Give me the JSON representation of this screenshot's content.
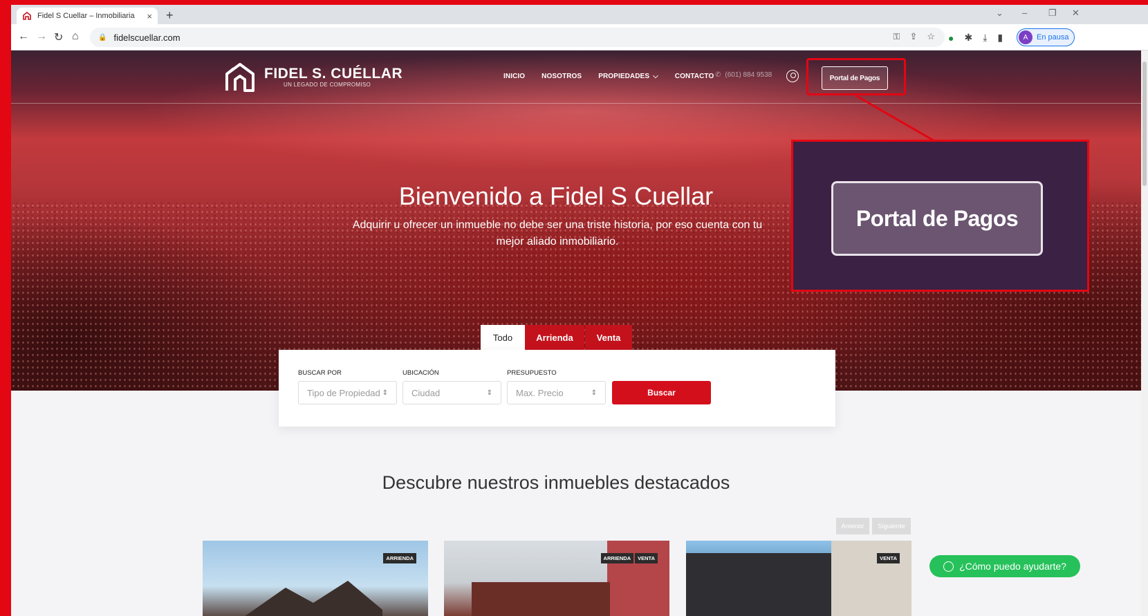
{
  "browser": {
    "tab_title": "Fidel S Cuellar – Inmobiliaria",
    "tab_close": "×",
    "new_tab": "+",
    "url": "fidelscuellar.com",
    "profile_initial": "A",
    "profile_status": "En pausa"
  },
  "site": {
    "brand_name": "FIDEL S. CUÉLLAR",
    "brand_tagline": "UN LEGADO DE COMPROMISO",
    "nav": {
      "inicio": "INICIO",
      "nosotros": "NOSOTROS",
      "propiedades": "PROPIEDADES",
      "contacto": "CONTACTO"
    },
    "phone": "(601) 884 9538",
    "portal_button": "Portal de Pagos"
  },
  "hero": {
    "title": "Bienvenido a Fidel S Cuellar",
    "subtitle": "Adquirir u ofrecer un inmueble no debe ser una triste historia, por eso cuenta con tu mejor aliado inmobiliario."
  },
  "callout": {
    "zoom_label": "Portal de Pagos"
  },
  "search": {
    "tabs": [
      "Todo",
      "Arrienda",
      "Venta"
    ],
    "active_tab": "Todo",
    "fields": [
      {
        "label": "BUSCAR POR",
        "placeholder": "Tipo de Propiedad"
      },
      {
        "label": "UBICACIÓN",
        "placeholder": "Ciudad"
      },
      {
        "label": "PRESUPUESTO",
        "placeholder": "Max. Precio"
      }
    ],
    "button": "Buscar"
  },
  "featured": {
    "title": "Descubre nuestros inmuebles destacados",
    "prev": "Anterior",
    "next": "Siguiente",
    "cards": [
      {
        "badges": [
          "ARRIENDA"
        ]
      },
      {
        "badges": [
          "ARRIENDA",
          "VENTA"
        ]
      },
      {
        "badges": [
          "VENTA"
        ]
      }
    ]
  },
  "whatsapp": {
    "label": "¿Cómo puedo ayudarte?"
  },
  "colors": {
    "brand_red": "#d40f1c",
    "annotation_red": "#e30613",
    "whatsapp_green": "#26c15a"
  }
}
